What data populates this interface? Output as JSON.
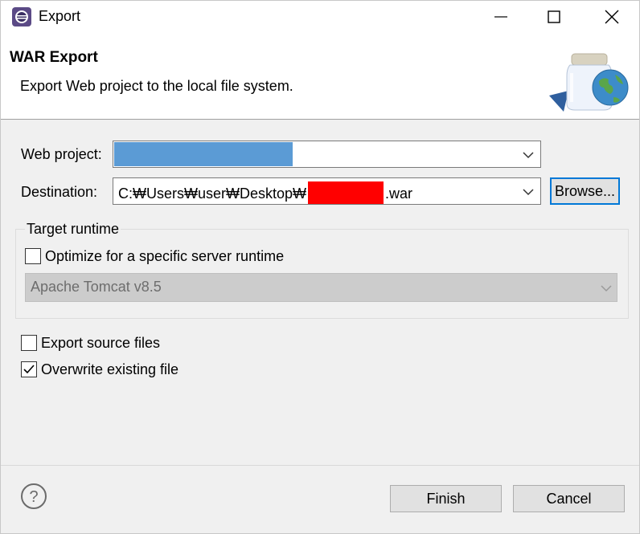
{
  "window": {
    "title": "Export",
    "icon": "eclipse-app-icon"
  },
  "banner": {
    "title": "WAR Export",
    "description": "Export Web project to the local file system.",
    "image": "jar-globe-icon"
  },
  "form": {
    "web_project_label": "Web project:",
    "web_project_value": "",
    "destination_label": "Destination:",
    "destination_prefix": "C:₩Users₩user₩Desktop₩",
    "destination_suffix": ".war",
    "browse_label": "Browse..."
  },
  "target_runtime": {
    "group_title": "Target runtime",
    "optimize_label": "Optimize for a specific server runtime",
    "optimize_checked": false,
    "runtime_value": "Apache Tomcat v8.5"
  },
  "options": {
    "export_source_label": "Export source files",
    "export_source_checked": false,
    "overwrite_label": "Overwrite existing file",
    "overwrite_checked": true
  },
  "footer": {
    "finish_label": "Finish",
    "cancel_label": "Cancel",
    "help_icon": "help-icon"
  },
  "colors": {
    "redaction_blue": "#5b9bd5",
    "redaction_red": "#ff0000",
    "focus_blue": "#0078d7"
  }
}
